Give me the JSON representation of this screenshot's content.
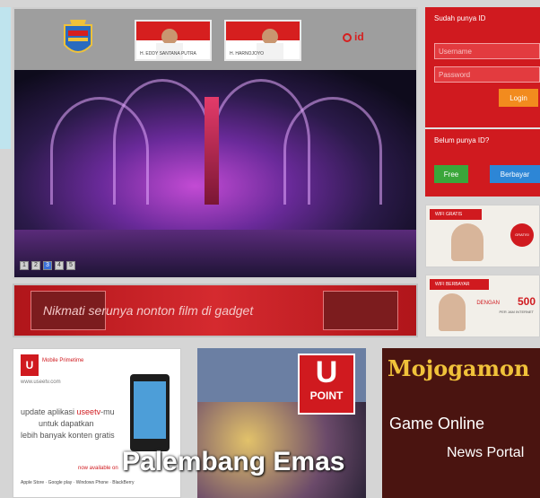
{
  "header": {
    "official_left_caption": "H. EDDY SANTANA PUTRA",
    "official_right_caption": "H. HARNOJOYO",
    "useeid_label": "id"
  },
  "slider": {
    "pages": [
      "1",
      "2",
      "3",
      "4",
      "5"
    ],
    "active_index": 2
  },
  "login": {
    "title": "Sudah punya ID",
    "username_placeholder": "Username",
    "password_placeholder": "Password",
    "login_label": "Login"
  },
  "register": {
    "title": "Belum punya ID?",
    "free_label": "Free",
    "paid_label": "Berbayar"
  },
  "promos": {
    "wifi_free_tag": "WIFI GRATIS",
    "wifi_free_badge": "GRATIS!",
    "wifi_paid_tag": "WIFI BERBAYAR",
    "wifi_paid_price": "500",
    "wifi_paid_prefix": "DENGAN",
    "wifi_paid_sub": "PER JAM INTERNET"
  },
  "banner": {
    "text": "Nikmati serunya nonton film di gadget"
  },
  "cards": {
    "useetv_logo": "U",
    "useetv_brand": "Mobile Primetime",
    "useetv_url": "www.useetv.com",
    "useetv_line1_pre": "update aplikasi ",
    "useetv_line1_hl": "useetv",
    "useetv_line1_post": "-mu",
    "useetv_line2": "untuk dapatkan",
    "useetv_line3": "lebih banyak konten gratis",
    "useetv_available": "now available on",
    "useetv_stores": "Apple Store · Google play · Windows Phone · BlackBerry",
    "upoint_u": "U",
    "upoint_label": "POINT",
    "mojo_title": "Mojogamon",
    "mojo_sub1": "Game Online",
    "mojo_sub2": "News Portal"
  },
  "overlay_title": "Palembang Emas"
}
